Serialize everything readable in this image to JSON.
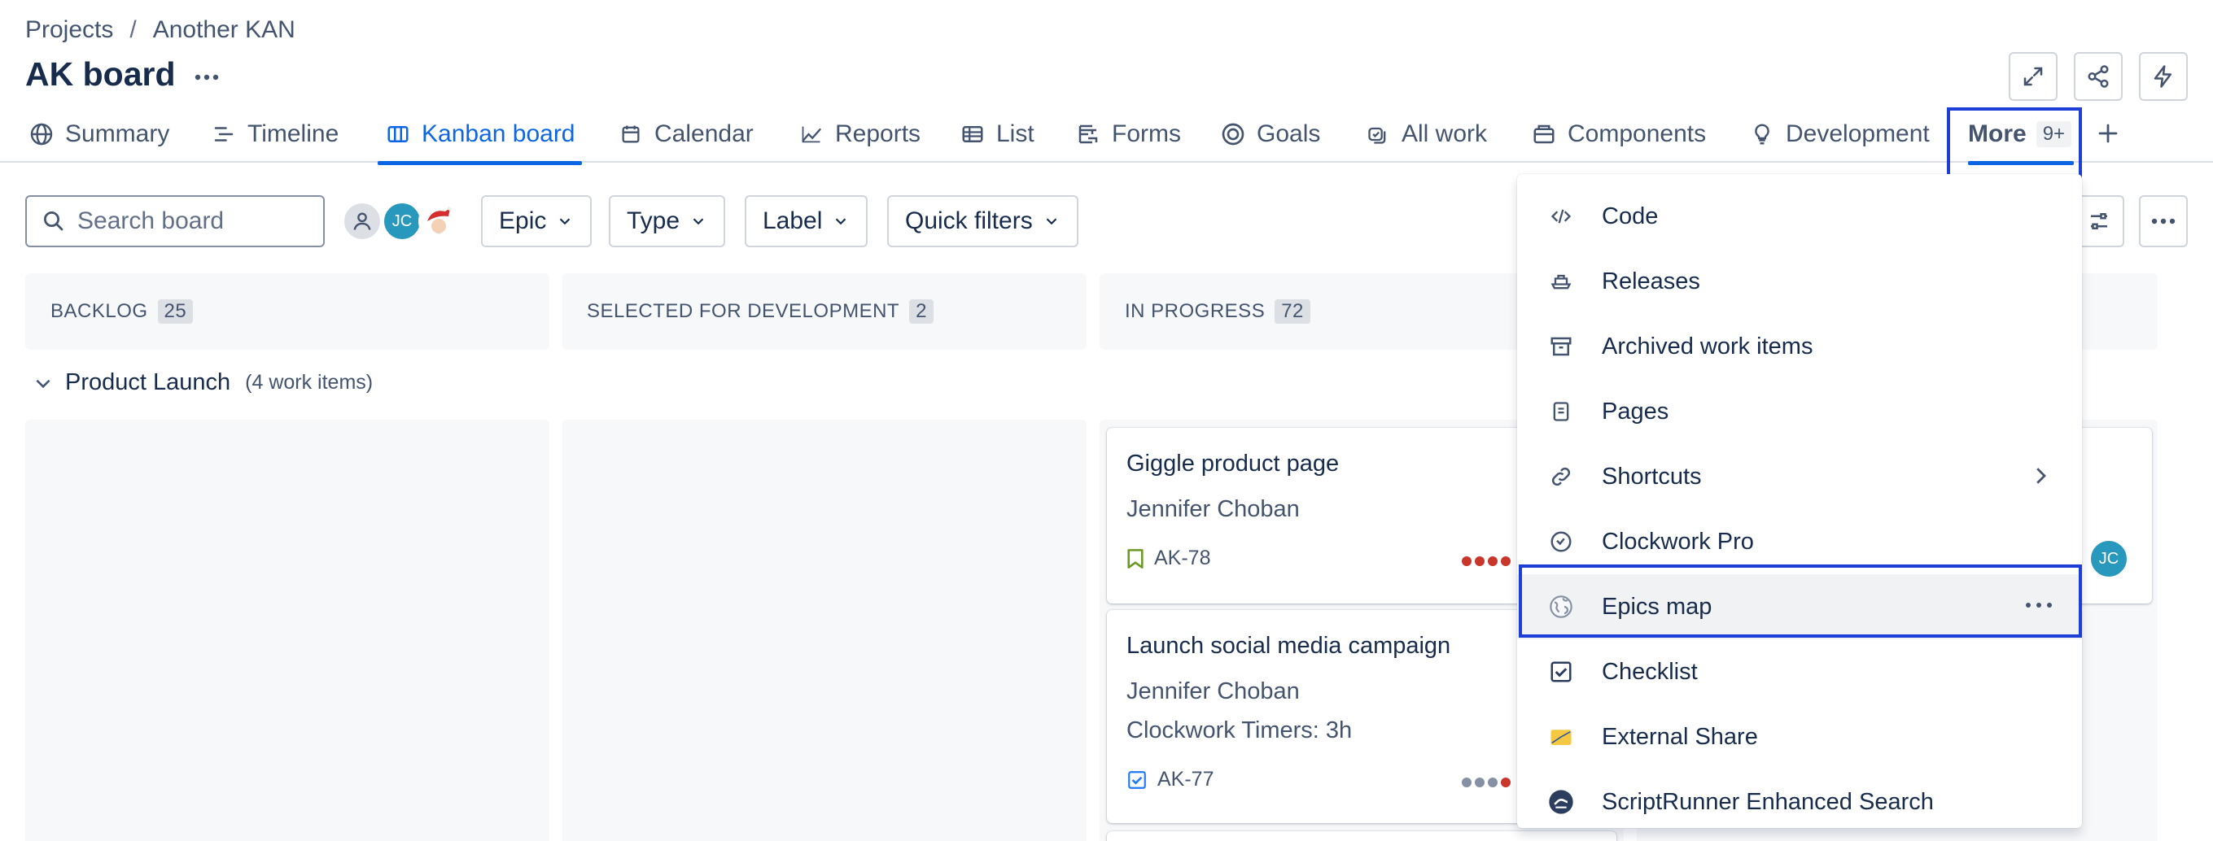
{
  "breadcrumb": {
    "projects": "Projects",
    "separator": "/",
    "project": "Another KAN"
  },
  "page": {
    "title": "AK board",
    "more_label": "···"
  },
  "tabs": [
    {
      "label": "Summary",
      "icon": "globe-icon"
    },
    {
      "label": "Timeline",
      "icon": "timeline-icon"
    },
    {
      "label": "Kanban board",
      "icon": "board-icon",
      "active": true
    },
    {
      "label": "Calendar",
      "icon": "calendar-icon"
    },
    {
      "label": "Reports",
      "icon": "chart-icon"
    },
    {
      "label": "List",
      "icon": "list-icon"
    },
    {
      "label": "Forms",
      "icon": "forms-icon"
    },
    {
      "label": "Goals",
      "icon": "target-icon"
    },
    {
      "label": "All work",
      "icon": "all-work-icon"
    },
    {
      "label": "Components",
      "icon": "components-icon"
    },
    {
      "label": "Development",
      "icon": "lightbulb-icon"
    }
  ],
  "more_tab": {
    "label": "More",
    "badge": "9+"
  },
  "toolbar": {
    "search_placeholder": "Search board",
    "avatar_initials": "JC",
    "filters": [
      "Epic",
      "Type",
      "Label",
      "Quick filters"
    ]
  },
  "columns": [
    {
      "name": "BACKLOG",
      "count": "25"
    },
    {
      "name": "SELECTED FOR DEVELOPMENT",
      "count": "2"
    },
    {
      "name": "IN PROGRESS",
      "count": "72"
    }
  ],
  "swimlane": {
    "name": "Product Launch",
    "count": "(4 work items)"
  },
  "cards": [
    {
      "title": "Giggle product page",
      "assignee": "Jennifer Choban",
      "extra": "",
      "key": "AK-78"
    },
    {
      "title": "Launch social media campaign",
      "assignee": "Jennifer Choban",
      "extra": "Clockwork Timers: 3h",
      "key": "AK-77"
    }
  ],
  "right_card_avatar": "JC",
  "menu": {
    "items": [
      {
        "label": "Code",
        "icon": "code-icon"
      },
      {
        "label": "Releases",
        "icon": "ship-icon"
      },
      {
        "label": "Archived work items",
        "icon": "archive-icon"
      },
      {
        "label": "Pages",
        "icon": "page-icon"
      },
      {
        "label": "Shortcuts",
        "icon": "link-icon",
        "submenu": true
      },
      {
        "label": "Clockwork Pro",
        "icon": "clock-icon"
      },
      {
        "label": "Epics map",
        "icon": "world-map-icon",
        "hover": true
      },
      {
        "label": "Checklist",
        "icon": "checkbox-icon"
      },
      {
        "label": "External Share",
        "icon": "external-share-icon"
      },
      {
        "label": "ScriptRunner Enhanced Search",
        "icon": "scriptrunner-icon"
      }
    ]
  },
  "colors": {
    "accent": "#0c66e4",
    "highlight": "#1d3fd8",
    "story_green": "#6a9a23",
    "task_blue": "#1d7afc",
    "priority_red": "#c9372c",
    "avatar_teal": "#2898bd"
  }
}
